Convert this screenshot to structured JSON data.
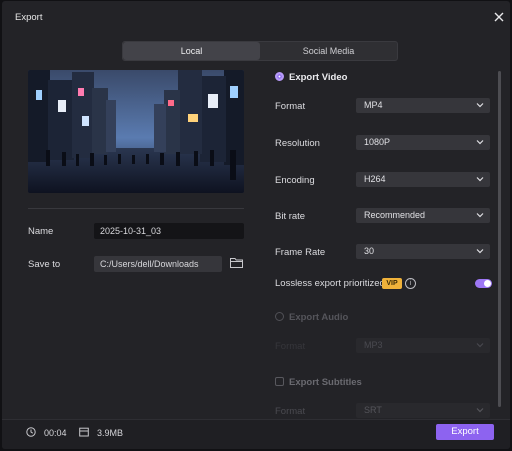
{
  "window": {
    "title": "Export"
  },
  "tabs": [
    {
      "label": "Local"
    },
    {
      "label": "Social Media"
    }
  ],
  "left": {
    "name_label": "Name",
    "name_value": "2025-10-31_03",
    "save_label": "Save to",
    "save_value": "C:/Users/dell/Downloads"
  },
  "video": {
    "title": "Export Video",
    "format_label": "Format",
    "format_value": "MP4",
    "resolution_label": "Resolution",
    "resolution_value": "1080P",
    "encoding_label": "Encoding",
    "encoding_value": "H264",
    "bitrate_label": "Bit rate",
    "bitrate_value": "Recommended",
    "framerate_label": "Frame Rate",
    "framerate_value": "30",
    "lossless_label": "Lossless export prioritized",
    "vip_badge": "VIP",
    "info_glyph": "i",
    "lossless_enabled": true
  },
  "audio": {
    "title": "Export Audio",
    "format_label": "Format",
    "format_value": "MP3"
  },
  "subtitles": {
    "title": "Export Subtitles",
    "format_label": "Format",
    "format_value": "SRT"
  },
  "footer": {
    "duration": "00:04",
    "size": "3.9MB",
    "export_label": "Export"
  },
  "colors": {
    "accent": "#8d63f0",
    "vip": "#f0b23a",
    "background": "#232327"
  },
  "icons": [
    "close-icon",
    "folder-icon",
    "chevron-down-icon",
    "clock-icon",
    "file-size-icon",
    "info-icon"
  ]
}
